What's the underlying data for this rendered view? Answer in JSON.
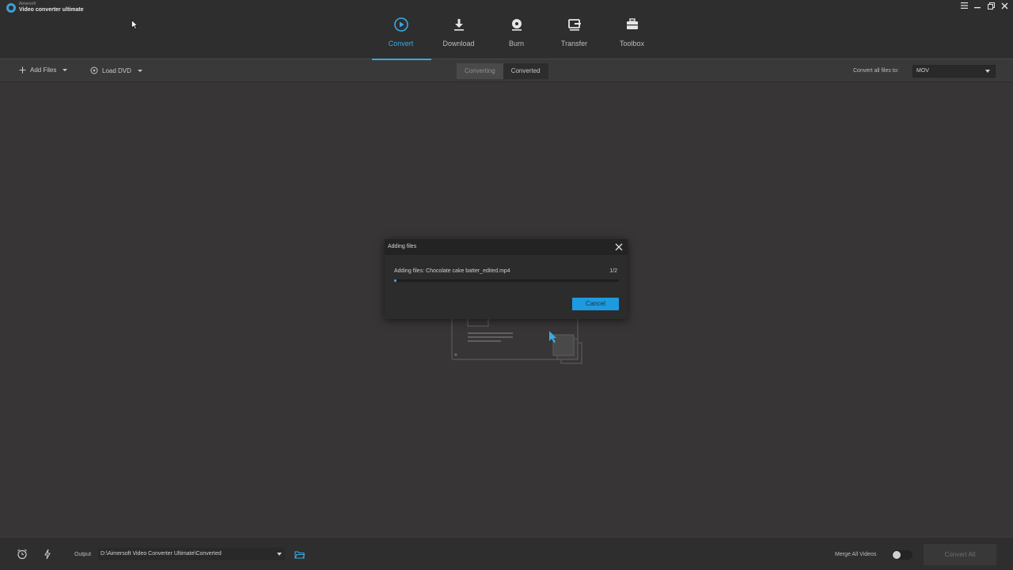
{
  "app": {
    "brand": "Aimersoft",
    "product": "Video converter ultimate"
  },
  "nav": {
    "items": [
      {
        "label": "Convert",
        "icon": "convert-icon",
        "active": true
      },
      {
        "label": "Download",
        "icon": "download-icon",
        "active": false
      },
      {
        "label": "Burn",
        "icon": "burn-icon",
        "active": false
      },
      {
        "label": "Transfer",
        "icon": "transfer-icon",
        "active": false
      },
      {
        "label": "Toolbox",
        "icon": "toolbox-icon",
        "active": false
      }
    ]
  },
  "window_controls": [
    "menu-icon",
    "minimize-icon",
    "restore-icon",
    "close-icon"
  ],
  "toolbar": {
    "add_files": "Add Files",
    "load_dvd": "Load DVD",
    "tabs": [
      {
        "label": "Converting",
        "active": true
      },
      {
        "label": "Converted",
        "active": false
      }
    ],
    "convert_all_to_label": "Convert all files to:",
    "format_value": "MOV"
  },
  "dialog": {
    "title": "Adding files",
    "message": "Adding files: Chocolate cake batter_edited.mp4",
    "count": "1/2",
    "progress": 0.01,
    "cancel_label": "Cancel"
  },
  "bottom": {
    "output_label": "Output",
    "output_path": "D:\\Aimersoft Video Converter Ultimate\\Converted",
    "merge_label": "Merge All Videos",
    "merge_enabled": false,
    "convert_all_label": "Convert All"
  },
  "colors": {
    "accent": "#38a9e4",
    "background": "#373535",
    "bar": "#2f2e2e"
  }
}
